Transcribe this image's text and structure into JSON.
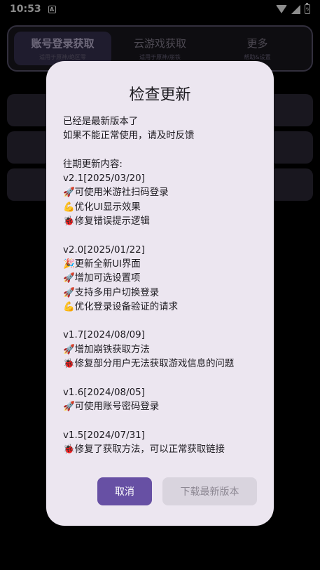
{
  "status_bar": {
    "time": "10:53",
    "notification_glyph": "A",
    "battery_glyph": "ϟ",
    "icons": [
      "notification-icon",
      "wifi-icon",
      "signal-icon",
      "battery-icon"
    ]
  },
  "tabs": [
    {
      "label": "账号登录获取",
      "sub": "适用于原神/绝区零",
      "active": true
    },
    {
      "label": "云游戏获取",
      "sub": "适用于原神/崩铁",
      "active": false
    },
    {
      "label": "更多",
      "sub": "帮助&设置",
      "active": false
    }
  ],
  "dialog": {
    "title": "检查更新",
    "lines": [
      "已经是最新版本了",
      "如果不能正常使用，请及时反馈",
      "",
      "往期更新内容:",
      "v2.1[2025/03/20]",
      "🚀可使用米游社扫码登录",
      "💪优化UI显示效果",
      "🐞修复错误提示逻辑",
      "",
      "v2.0[2025/01/22]",
      "🎉更新全新UI界面",
      "🚀增加可选设置项",
      "🚀支持多用户切换登录",
      "💪优化登录设备验证的请求",
      "",
      "v1.7[2024/08/09]",
      "🚀增加崩铁获取方法",
      "🐞修复部分用户无法获取游戏信息的问题",
      "",
      "v1.6[2024/08/05]",
      "🚀可使用账号密码登录",
      "",
      "v1.5[2024/07/31]",
      "🐞修复了获取方法，可以正常获取链接"
    ],
    "cancel_label": "取消",
    "download_label": "下载最新版本"
  },
  "colors": {
    "dialog_bg": "#ece6f0",
    "primary": "#6750a4",
    "disabled_bg": "#d9d4de",
    "disabled_text": "#8d8893"
  }
}
